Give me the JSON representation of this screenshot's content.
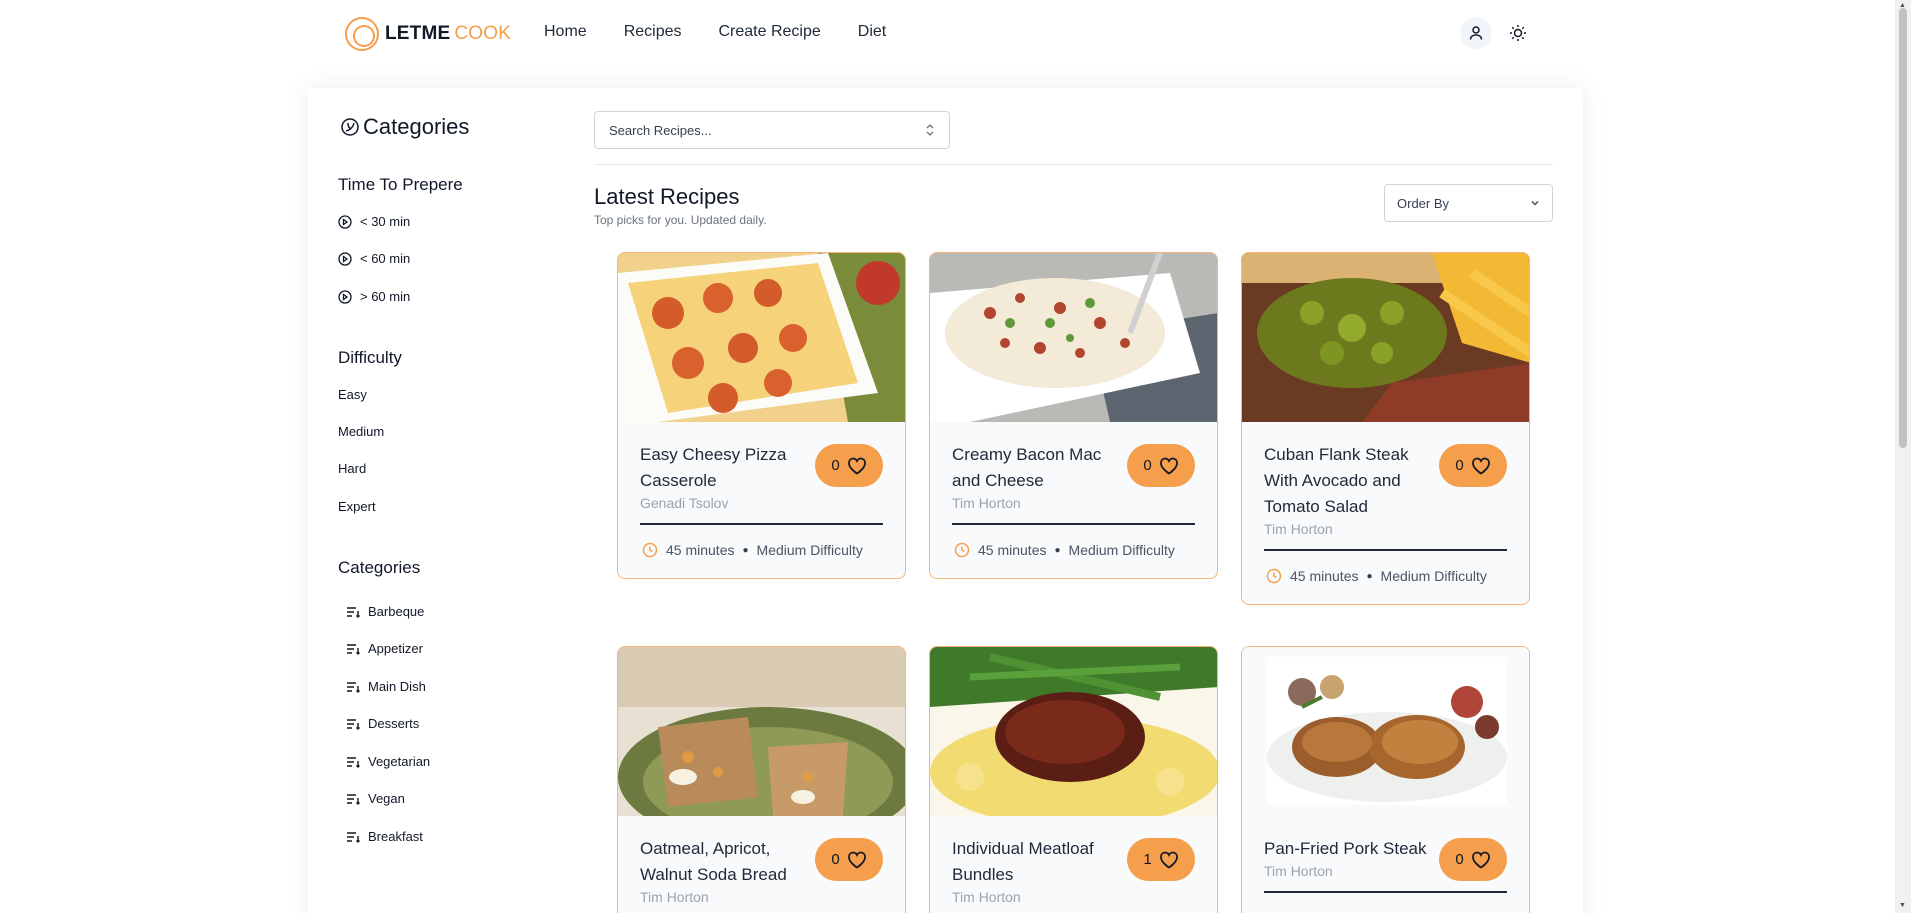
{
  "brand": {
    "name_a": "LETME",
    "name_b": "COOK"
  },
  "nav": [
    "Home",
    "Recipes",
    "Create Recipe",
    "Diet"
  ],
  "sidebar": {
    "title": "Categories",
    "time_heading": "Time To Prepere",
    "time_items": [
      "< 30 min",
      "< 60 min",
      "> 60 min"
    ],
    "difficulty_heading": "Difficulty",
    "difficulty_items": [
      "Easy",
      "Medium",
      "Hard",
      "Expert"
    ],
    "categories_heading": "Categories",
    "category_items": [
      "Barbeque",
      "Appetizer",
      "Main Dish",
      "Desserts",
      "Vegetarian",
      "Vegan",
      "Breakfast"
    ]
  },
  "search": {
    "placeholder": "Search Recipes..."
  },
  "latest": {
    "title": "Latest Recipes",
    "subtitle": "Top picks for you. Updated daily."
  },
  "order_by": {
    "label": "Order By"
  },
  "recipes": [
    {
      "title": "Easy Cheesy Pizza Casserole",
      "author": "Genadi Tsolov",
      "likes": "0",
      "time": "45 minutes",
      "difficulty": "Medium Difficulty"
    },
    {
      "title": "Creamy Bacon Mac and Cheese",
      "author": "Tim Horton",
      "likes": "0",
      "time": "45 minutes",
      "difficulty": "Medium Difficulty"
    },
    {
      "title": "Cuban Flank Steak With Avocado and Tomato Salad",
      "author": "Tim Horton",
      "likes": "0",
      "time": "45 minutes",
      "difficulty": "Medium Difficulty"
    },
    {
      "title": "Oatmeal, Apricot, Walnut Soda Bread",
      "author": "Tim Horton",
      "likes": "0"
    },
    {
      "title": "Individual Meatloaf Bundles",
      "author": "Tim Horton",
      "likes": "1"
    },
    {
      "title": "Pan-Fried Pork Steak",
      "author": "Tim Horton",
      "likes": "0"
    }
  ],
  "colors": {
    "accent": "#f59e4c",
    "card_border": "#f5b57a",
    "card_bg": "#f8fafc"
  },
  "icons": [
    "orange-logo-icon",
    "user-icon",
    "sun-icon",
    "leaf-circle-icon",
    "clock-play-icon",
    "list-icon",
    "chevron-updown-icon",
    "chevron-down-icon",
    "heart-icon",
    "clock-icon"
  ]
}
